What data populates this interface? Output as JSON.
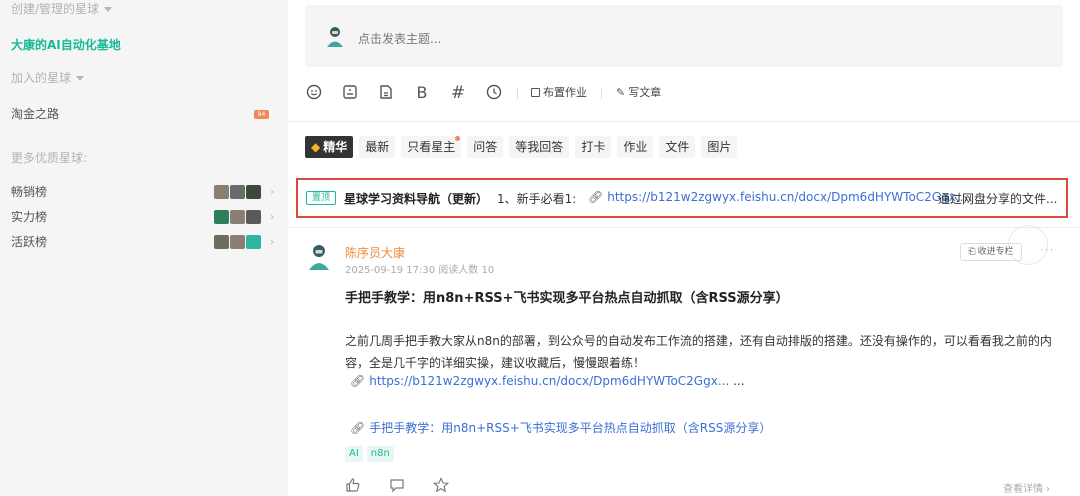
{
  "sidebar": {
    "section_created": "创建/管理的星球",
    "active_planet": "大康的AI自动化基地",
    "section_joined": "加入的星球",
    "joined_planet": "淘金之路",
    "joined_badge": "94",
    "section_more": "更多优质星球:",
    "rankings": [
      {
        "label": "畅销榜",
        "chevron": "›"
      },
      {
        "label": "实力榜",
        "chevron": "›"
      },
      {
        "label": "活跃榜",
        "chevron": "›"
      }
    ]
  },
  "composer": {
    "placeholder": "点击发表主题..."
  },
  "toolbar": {
    "icons": [
      "emoji-icon",
      "image-icon",
      "file-icon",
      "bold-icon",
      "hashtag-icon",
      "clock-icon"
    ],
    "bold_glyph": "B",
    "hash_glyph": "#",
    "assign_label": "布置作业",
    "write_label": "写文章"
  },
  "tabs": [
    {
      "label": "精华",
      "active": true
    },
    {
      "label": "最新"
    },
    {
      "label": "只看星主",
      "dot": true
    },
    {
      "label": "问答"
    },
    {
      "label": "等我回答"
    },
    {
      "label": "打卡"
    },
    {
      "label": "作业"
    },
    {
      "label": "文件"
    },
    {
      "label": "图片"
    }
  ],
  "pinned": {
    "tag": "置顶",
    "title": "星球学习资料导航（更新）",
    "text": "1、新手必看1:",
    "link": "https://b121w2zgwyx.feishu.cn/docx/Dpm6dHYWToC2Ggx...",
    "tail": "通过网盘分享的文件..."
  },
  "post": {
    "author": "陈序员大康",
    "meta": "2025-09-19 17:30  阅读人数 10",
    "collect_label": "收进专栏",
    "more": "···",
    "title": "手把手教学：用n8n+RSS+飞书实现多平台热点自动抓取（含RSS源分享）",
    "body": "之前几周手把手教大家从n8n的部署，到公众号的自动发布工作流的搭建，还有自动排版的搭建。还没有操作的，可以看看我之前的内容，全是几千字的详细实操，建议收藏后，慢慢跟着练！",
    "link": "https://b121w2zgwyx.feishu.cn/docx/Dpm6dHYWToC2Ggx...",
    "link_tail": "...",
    "link2": "手把手教学：用n8n+RSS+飞书实现多平台热点自动抓取（含RSS源分享）",
    "tags": [
      "AI",
      "n8n"
    ],
    "view_detail": "查看详情"
  },
  "colors": {
    "accent": "#16b998",
    "link": "#3b6fd6",
    "highlight_border": "#e0473e",
    "author": "#f08a3d"
  }
}
